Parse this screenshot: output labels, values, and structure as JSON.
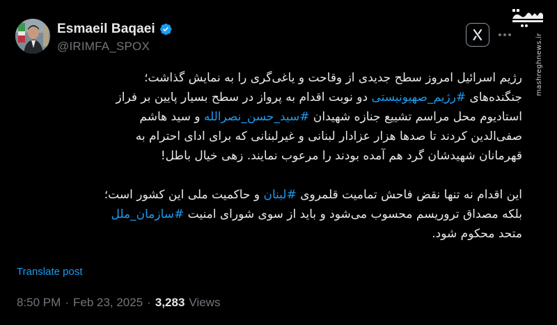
{
  "author": {
    "display_name": "Esmaeil Baqaei",
    "handle": "@IRIMFA_SPOX",
    "verified": true
  },
  "watermark": {
    "logo_text": "مشرق",
    "site": "mashreghnews.ir"
  },
  "post": {
    "paragraph1": [
      [
        {
          "t": "رژیم اسرائیل امروز سطح جدیدی از وقاحت و یاغی‌گری را به نمایش گذاشت؛"
        }
      ],
      [
        {
          "t": "جنگنده‌های "
        },
        {
          "t": "#رژیم_صهیونیستی",
          "tag": true
        },
        {
          "t": " دو نوبت اقدام به پرواز در سطح بسیار پایین بر فراز"
        }
      ],
      [
        {
          "t": "استادیوم محل مراسم تشییع جنازه شهیدان "
        },
        {
          "t": "#سید_حسن_نصرالله",
          "tag": true
        },
        {
          "t": " و سید هاشم"
        }
      ],
      [
        {
          "t": "صفی‌الدین کردند تا صدها هزار عزادار لبنانی و غیرلبنانی که برای ادای احترام به"
        }
      ],
      [
        {
          "t": "قهرمانان شهیدشان گرد هم آمده بودند را مرعوب نمایند. زهی خیال باطل!"
        }
      ]
    ],
    "paragraph2": [
      [
        {
          "t": "این اقدام نه تنها نقض فاحش تمامیت قلمروی "
        },
        {
          "t": "#لبنان",
          "tag": true
        },
        {
          "t": " و حاکمیت ملی این کشور است؛"
        }
      ],
      [
        {
          "t": "بلکه مصداق تروریسم محسوب می‌شود و باید از سوی شورای امنیت "
        },
        {
          "t": "#سازمان_ملل",
          "tag": true
        }
      ],
      [
        {
          "t": "متحد محکوم شود."
        }
      ]
    ]
  },
  "translate_label": "Translate post",
  "meta": {
    "time": "8:50 PM",
    "separator": "·",
    "date": "Feb 23, 2025",
    "views_count": "3,283",
    "views_label": "Views"
  },
  "icons": {
    "verified": "verified-badge-icon",
    "grok": "grok-icon",
    "more": "more-icon"
  },
  "colors": {
    "background": "#000000",
    "text": "#e7e9ea",
    "secondary": "#71767b",
    "accent": "#1d9bf0"
  }
}
